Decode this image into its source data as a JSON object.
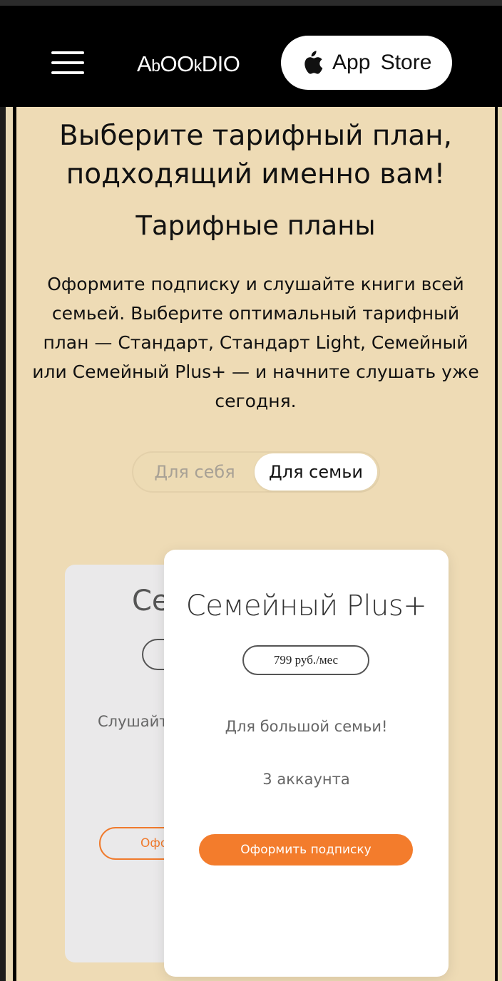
{
  "header": {
    "logo": {
      "p1": "A",
      "p2": "b",
      "p3": "OO",
      "p4": "k",
      "p5": "DIO"
    },
    "app_store_label": "App Store",
    "menu_icon": "hamburger-icon",
    "store_icon": "apple-icon"
  },
  "main": {
    "headline": "Выберите тарифный план, подходящий именно вам!",
    "subheading": "Тарифные планы",
    "description": "Оформите подписку и слушайте книги всей семьей. Выберите оптимальный тарифный план — Стандарт, Стандарт Light, Семейный или Семейный Plus+ — и начните слушать уже сегодня."
  },
  "toggle": {
    "options": [
      "Для себя",
      "Для семьи"
    ],
    "selected": "Для семьи"
  },
  "cards": {
    "back": {
      "title_partial": "Се",
      "desc_partial": "Слушайт",
      "button_partial": "Офо"
    },
    "front": {
      "title": "Семейный Plus+",
      "price": "799 руб./мес",
      "description": "Для большой семьи!",
      "accounts": "3 аккаунта",
      "button_label": "Оформить подписку"
    }
  },
  "colors": {
    "background": "#eedbb5",
    "header": "#000000",
    "accent": "#f37c2c",
    "card": "#ffffff",
    "card_back": "#eae9ea"
  }
}
